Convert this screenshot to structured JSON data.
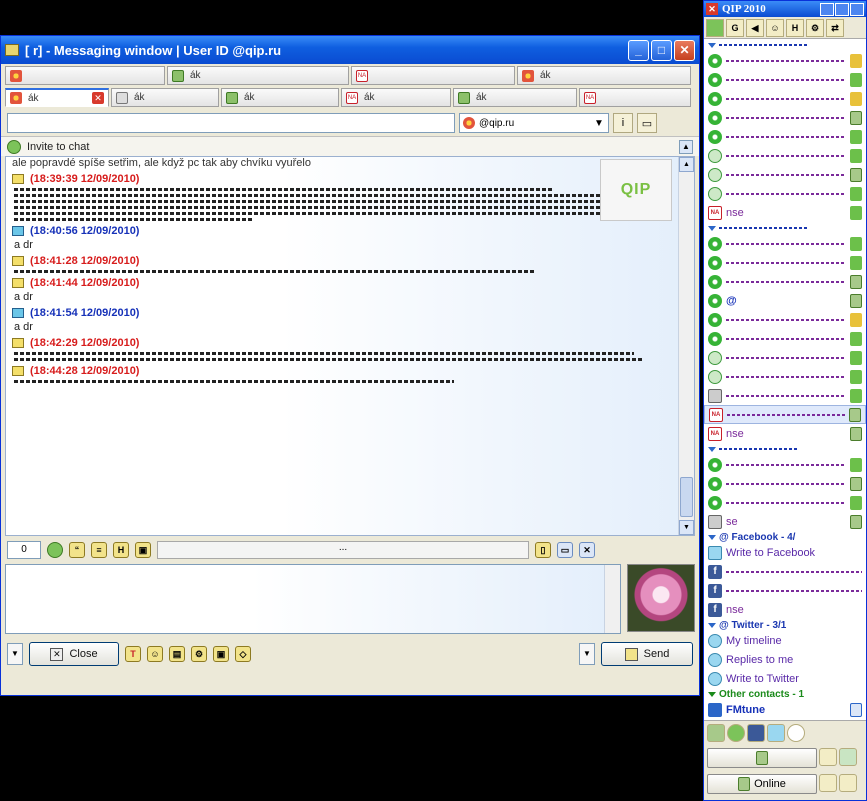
{
  "msgwin": {
    "title": "[ r] - Messaging window | User ID @qip.ru",
    "tabs_row1": [
      {
        "label": "",
        "icon": "daisy-icon"
      },
      {
        "label": "ák",
        "icon": "lock-icon"
      },
      {
        "label": "",
        "icon": "na-icon"
      },
      {
        "label": "ák",
        "icon": "daisy-icon"
      }
    ],
    "tabs_row2": [
      {
        "label": "ák",
        "icon": "daisy-icon",
        "active": true
      },
      {
        "label": "ák",
        "icon": "gray-icon"
      },
      {
        "label": "ák",
        "icon": "lock-icon"
      },
      {
        "label": "ák",
        "icon": "na-icon"
      },
      {
        "label": "ák",
        "icon": "lock-icon"
      },
      {
        "label": "",
        "icon": "na-icon"
      }
    ],
    "contact_name": "",
    "contact_id": "@qip.ru",
    "invite_label": "Invite to chat",
    "history_first_line": "ale popravdé spíše setřim, ale když pc tak aby chvíku vyuřelo",
    "qip_logo": "QIP",
    "messages": [
      {
        "dir": "in",
        "time": "(18:39:39 12/09/2010)",
        "body": ""
      },
      {
        "dir": "out",
        "time": "(18:40:56 12/09/2010)",
        "body": "a dr"
      },
      {
        "dir": "in",
        "time": "(18:41:28 12/09/2010)",
        "body": ""
      },
      {
        "dir": "in",
        "time": "(18:41:44 12/09/2010)",
        "body": "a dr"
      },
      {
        "dir": "out",
        "time": "(18:41:54 12/09/2010)",
        "body": "a dr"
      },
      {
        "dir": "in",
        "time": "(18:42:29 12/09/2010)",
        "body": ""
      },
      {
        "dir": "in",
        "time": "(18:44:28 12/09/2010)",
        "body": ""
      }
    ],
    "char_count": "0",
    "status_field": "...",
    "close_label": "Close",
    "send_label": "Send"
  },
  "qip": {
    "title": "QIP 2010",
    "write_facebook": "Write to Facebook",
    "facebook_group": "@ Facebook - 4/",
    "twitter_group": "@ Twitter - 3/1",
    "my_timeline": "My timeline",
    "replies": "Replies to me",
    "write_twitter": "Write to Twitter",
    "other_contacts": "Other contacts - 1",
    "fmtune": "FMtune",
    "online_label": "Online",
    "nse1": "nse",
    "nse2": "nse",
    "nse3": "se",
    "nse4": "nse",
    "at_symbol": "@"
  }
}
